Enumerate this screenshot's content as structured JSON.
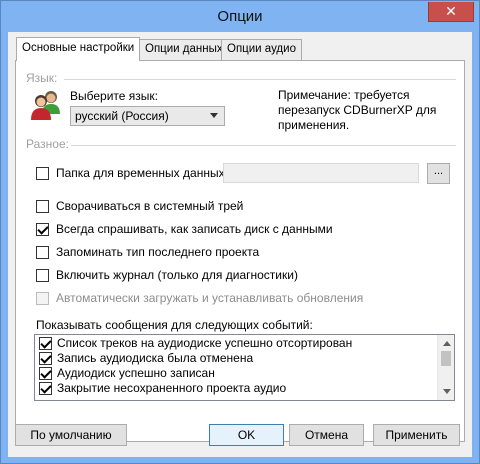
{
  "window": {
    "title": "Опции",
    "close_glyph": "✕"
  },
  "tabs": [
    {
      "label": "Основные настройки",
      "active": true
    },
    {
      "label": "Опции данных",
      "active": false
    },
    {
      "label": "Опции аудио",
      "active": false
    }
  ],
  "language": {
    "group_label": "Язык:",
    "select_label": "Выберите язык:",
    "selected": "русский (Россия)",
    "note": "Примечание: требуется перезапуск CDBurnerXP для применения.",
    "note_lines": [
      "Примечание: требуется",
      "перезапуск CDBurnerXP для",
      "применения."
    ],
    "icon": "users-icon"
  },
  "misc": {
    "group_label": "Разное:",
    "temp_folder_label": "Папка для временных данных:",
    "temp_folder_value": "",
    "browse_label": "...",
    "options": [
      {
        "label": "Сворачиваться в системный трей",
        "checked": false,
        "disabled": false
      },
      {
        "label": "Всегда спрашивать, как записать диск с данными",
        "checked": true,
        "disabled": false
      },
      {
        "label": "Запоминать тип последнего проекта",
        "checked": false,
        "disabled": false
      },
      {
        "label": "Включить журнал (только для диагностики)",
        "checked": false,
        "disabled": false
      },
      {
        "label": "Автоматически загружать и устанавливать обновления",
        "checked": false,
        "disabled": true
      }
    ],
    "temp_folder_checked": false
  },
  "events": {
    "label": "Показывать сообщения для следующих событий:",
    "items": [
      {
        "label": "Список треков на аудиодиске успешно отсортирован",
        "checked": true
      },
      {
        "label": "Запись аудиодиска была отменена",
        "checked": true
      },
      {
        "label": "Аудиодиск успешно записан",
        "checked": true
      },
      {
        "label": "Закрытие несохраненного проекта аудио",
        "checked": true
      }
    ]
  },
  "buttons": {
    "defaults": "По умолчанию",
    "ok": "OK",
    "cancel": "Отмена",
    "apply": "Применить"
  },
  "colors": {
    "titlebar": "#80b3f1",
    "close": "#c7504a",
    "default_button_border": "#3c7fb1"
  }
}
